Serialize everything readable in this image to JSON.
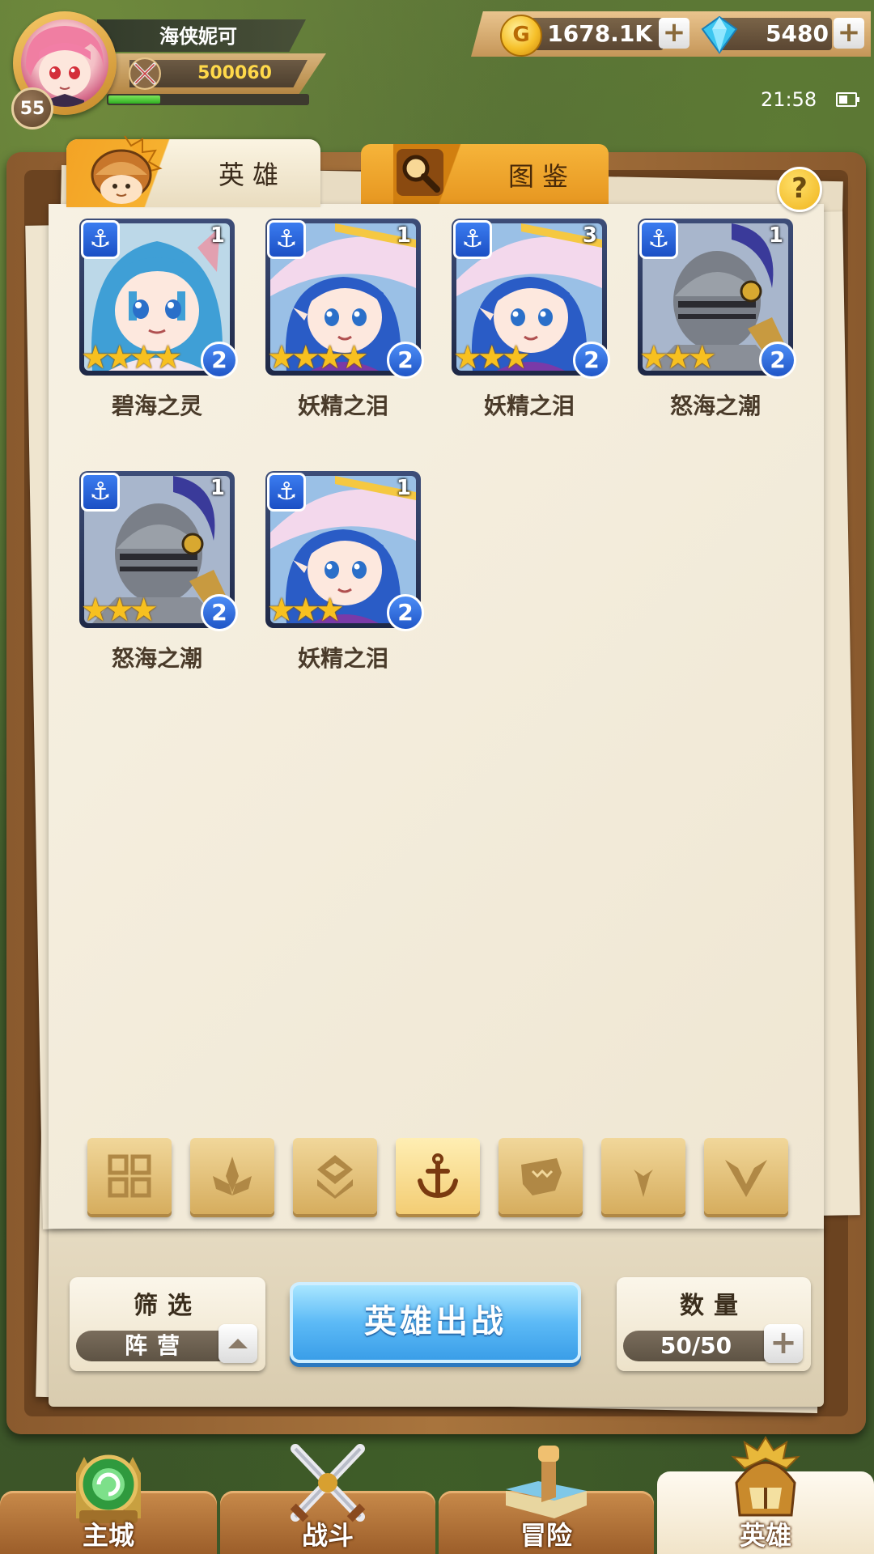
{
  "player": {
    "name": "海侠妮可",
    "level": "55",
    "power": "500060",
    "exp_fraction": 0.26
  },
  "resources": {
    "gold": "1678.1K",
    "gems": "5480",
    "plus": "+"
  },
  "status": {
    "time": "21:58"
  },
  "tabs": [
    {
      "label": "英雄"
    },
    {
      "label": "图鉴"
    }
  ],
  "help_label": "?",
  "heroes": [
    {
      "name": "碧海之灵",
      "stars": 4,
      "star_glyphs": "★★★★",
      "copies": "1",
      "rank": "2",
      "portrait": "cat-girl"
    },
    {
      "name": "妖精之泪",
      "stars": 4,
      "star_glyphs": "★★★★",
      "copies": "1",
      "rank": "2",
      "portrait": "witch"
    },
    {
      "name": "妖精之泪",
      "stars": 3,
      "star_glyphs": "★★★",
      "copies": "3",
      "rank": "2",
      "portrait": "witch"
    },
    {
      "name": "怒海之潮",
      "stars": 3,
      "star_glyphs": "★★★",
      "copies": "1",
      "rank": "2",
      "portrait": "knight"
    },
    {
      "name": "怒海之潮",
      "stars": 3,
      "star_glyphs": "★★★",
      "copies": "1",
      "rank": "2",
      "portrait": "knight"
    },
    {
      "name": "妖精之泪",
      "stars": 3,
      "star_glyphs": "★★★",
      "copies": "1",
      "rank": "2",
      "portrait": "witch"
    }
  ],
  "faction_filters": [
    "all-grid-icon",
    "leaf-faction-icon",
    "diamond-faction-icon",
    "anchor-faction-icon",
    "beast-faction-icon",
    "horn-faction-icon",
    "wing-faction-icon"
  ],
  "active_filter": "anchor-faction-icon",
  "filter_panel": {
    "title": "筛选",
    "value": "阵营"
  },
  "deploy_button": "英雄出战",
  "count_panel": {
    "title": "数量",
    "value": "50/50"
  },
  "nav": [
    {
      "label": "主城",
      "icon": "main-city-icon"
    },
    {
      "label": "战斗",
      "icon": "crossed-swords-icon"
    },
    {
      "label": "冒险",
      "icon": "adventure-map-icon"
    },
    {
      "label": "英雄",
      "icon": "hero-helmet-icon",
      "active": true
    }
  ]
}
